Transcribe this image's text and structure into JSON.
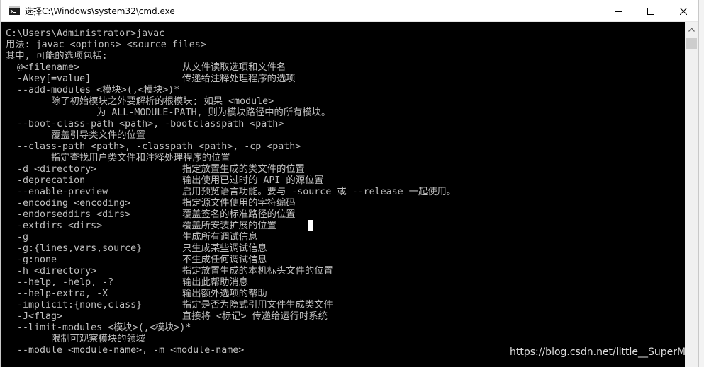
{
  "window": {
    "title": "选择C:\\Windows\\system32\\cmd.exe",
    "icon": "cmd-icon",
    "controls": [
      "minimize-icon",
      "maximize-icon",
      "close-icon"
    ]
  },
  "console": {
    "lines": [
      {
        "text": "C:\\Users\\Administrator>javac",
        "desc": ""
      },
      {
        "text": "用法: javac <options> <source files>",
        "desc": ""
      },
      {
        "text": "其中, 可能的选项包括:",
        "desc": ""
      },
      {
        "text": "  @<filename>",
        "desc": "从文件读取选项和文件名"
      },
      {
        "text": "  -Akey[=value]",
        "desc": "传递给注释处理程序的选项"
      },
      {
        "text": "  --add-modules <模块>(,<模块>)*",
        "desc": ""
      },
      {
        "text": "        除了初始模块之外要解析的根模块; 如果 <module>",
        "desc": ""
      },
      {
        "text": "                为 ALL-MODULE-PATH, 则为模块路径中的所有模块。",
        "desc": ""
      },
      {
        "text": "  --boot-class-path <path>, -bootclasspath <path>",
        "desc": ""
      },
      {
        "text": "        覆盖引导类文件的位置",
        "desc": ""
      },
      {
        "text": "  --class-path <path>, -classpath <path>, -cp <path>",
        "desc": ""
      },
      {
        "text": "        指定查找用户类文件和注释处理程序的位置",
        "desc": ""
      },
      {
        "text": "  -d <directory>",
        "desc": "指定放置生成的类文件的位置"
      },
      {
        "text": "  -deprecation",
        "desc": "输出使用已过时的 API 的源位置"
      },
      {
        "text": "  --enable-preview",
        "desc": "启用预览语言功能。要与 -source 或 --release 一起使用。"
      },
      {
        "text": "  -encoding <encoding>",
        "desc": "指定源文件使用的字符编码"
      },
      {
        "text": "  -endorseddirs <dirs>",
        "desc": "覆盖签名的标准路径的位置"
      },
      {
        "text": "  -extdirs <dirs>",
        "desc": "覆盖所安装扩展的位置"
      },
      {
        "text": "  -g",
        "desc": "生成所有调试信息"
      },
      {
        "text": "  -g:{lines,vars,source}",
        "desc": "只生成某些调试信息"
      },
      {
        "text": "  -g:none",
        "desc": "不生成任何调试信息"
      },
      {
        "text": "  -h <directory>",
        "desc": "指定放置生成的本机标头文件的位置"
      },
      {
        "text": "  --help, -help, -?",
        "desc": "输出此帮助消息"
      },
      {
        "text": "  --help-extra, -X",
        "desc": "输出额外选项的帮助"
      },
      {
        "text": "  -implicit:{none,class}",
        "desc": "指定是否为隐式引用文件生成类文件"
      },
      {
        "text": "  -J<flag>",
        "desc": "直接将 <标记> 传递给运行时系统"
      },
      {
        "text": "  --limit-modules <模块>(,<模块>)*",
        "desc": ""
      },
      {
        "text": "        限制可观察模块的领域",
        "desc": ""
      },
      {
        "text": "  --module <module-name>, -m <module-name>",
        "desc": ""
      }
    ]
  },
  "watermark": "https://blog.csdn.net/little__SuperM",
  "colors": {
    "console_bg": "#000000",
    "console_fg": "#c0c0c0",
    "titlebar_bg": "#ffffff"
  }
}
